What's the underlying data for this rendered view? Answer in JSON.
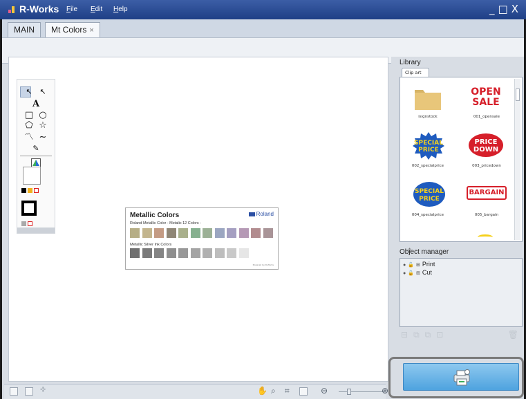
{
  "app": {
    "title": "R-Works",
    "menu": [
      {
        "label": "File",
        "accel": "F",
        "rest": "ile"
      },
      {
        "label": "Edit",
        "accel": "E",
        "rest": "dit"
      },
      {
        "label": "Help",
        "accel": "H",
        "rest": "elp"
      }
    ],
    "window_controls": "_□X"
  },
  "tabs": [
    {
      "label": "MAIN",
      "active": false
    },
    {
      "label": "Mt Colors",
      "active": true,
      "close_glyph": "×"
    }
  ],
  "toolbox": {
    "icons": [
      "select-pointer-icon",
      "node-edit-icon",
      "text-tool-icon",
      "rectangle-icon",
      "ellipse-icon",
      "polygon-icon",
      "star-icon",
      "polyline-icon",
      "curve-icon",
      "pen-icon",
      "color-fill-icon",
      "fill-color-swatch",
      "stroke-color-swatch"
    ],
    "text_tool_glyph": "A"
  },
  "document": {
    "title": "Metallic Colors",
    "brand": "Roland",
    "subtitle_metallic": "Roland Metallic Color - Metalic 12 Colors -",
    "subtitle_silver": "Metallic Silver Ink Colors",
    "metallic_colors": [
      "#b6ae86",
      "#c3b58e",
      "#c49b84",
      "#8f8676",
      "#a9b08c",
      "#86b08f",
      "#9cb196",
      "#9ba6c1",
      "#a59fc1",
      "#b599b5",
      "#b28c8f",
      "#a99497"
    ],
    "silver_colors": [
      "#707070",
      "#7a7a7a",
      "#848484",
      "#8e8e8e",
      "#989898",
      "#a4a4a4",
      "#b0b0b0",
      "#bdbdbd",
      "#c9c9c9",
      "#e6e6e6"
    ],
    "footer": "Powered by R-Works"
  },
  "statusbar": {
    "icons": [
      "grid-icon",
      "page-icon",
      "snap-icon",
      "hand-icon",
      "zoom-icon",
      "fit-icon",
      "fit-page-icon",
      "zoom-out-icon",
      "zoom-in-icon"
    ]
  },
  "library": {
    "label": "Library",
    "tab": "Clip art",
    "items": [
      {
        "name": "isignstock"
      },
      {
        "name": "001_opensale",
        "line1": "OPEN",
        "line2": "SALE"
      },
      {
        "name": "002_specialprice",
        "line1": "SPECIAL",
        "line2": "PRICE"
      },
      {
        "name": "003_pricedown",
        "line1": "PRICE",
        "line2": "DOWN"
      },
      {
        "name": "004_specialprice",
        "line1": "SPECIAL",
        "line2": "PRICE"
      },
      {
        "name": "005_bargain",
        "line1": "BARGAIN"
      }
    ]
  },
  "object_manager": {
    "label": "Object manager",
    "items": [
      {
        "label": "Print"
      },
      {
        "label": "Cut"
      }
    ]
  },
  "colors": {
    "titlebar": "#1e3f86",
    "accent": "#4ea3df",
    "sale_red": "#d61f2a",
    "special_blue": "#1e5bbf",
    "special_yellow": "#f5d01b"
  }
}
